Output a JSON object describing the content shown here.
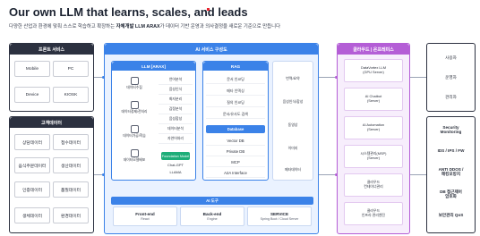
{
  "header": {
    "title": "Our own LLM that learns, scales, and leads",
    "subtitle_pre": "다양한 산업과 환경에 맞춰 스스로 학습하고 확장하는 ",
    "subtitle_bold": "자체개발 LLM ARAX",
    "subtitle_post": "가 데이터 기반 운영과 의사결정을 새로운 기준으로 만듭니다",
    "accent_color": "#e8242e"
  },
  "left_top": {
    "title": "프론트 서비스",
    "items": [
      "Mobile",
      "PC",
      "Device",
      "KIOSK"
    ]
  },
  "left_bottom": {
    "title": "고객데이터",
    "items": [
      "상담데이터",
      "접수데이터",
      "음식주문데이터",
      "생산데이터",
      "인증데이터",
      "품질데이터",
      "생체데이터",
      "환경데이터"
    ]
  },
  "center": {
    "title": "AI 서비스 구성도",
    "color": "#3b82e8",
    "llm": {
      "title": "LLM [ARAX]",
      "icons": [
        {
          "label": "데이터수집",
          "icon": "database-icon"
        },
        {
          "label": "데이터정제/전처리",
          "icon": "filter-icon"
        },
        {
          "label": "데이터가공/학습",
          "icon": "gear-icon"
        },
        {
          "label": "데이터모델배포",
          "icon": "cloud-icon"
        }
      ],
      "list": [
        "언어분석",
        "음성인식",
        "화자분리",
        "감정분석",
        "음성합성",
        "데이터분석",
        "자연어처리"
      ],
      "badge": "Foundation Model",
      "models": [
        "Chat-GPT",
        "LLAMA"
      ]
    },
    "rag": {
      "title": "RAG",
      "items": [
        "문서 인코딩",
        "메타 인덱싱",
        "질의 인코딩",
        "문서/유사도 검색"
      ],
      "database_title": "Database",
      "database_items": [
        "Vector DB",
        "Private DB",
        "MCP",
        "A2A Interface"
      ]
    },
    "mid_right": [
      "번역/요약",
      "음성인식/합성",
      "동영상",
      "이미지",
      "메타데이터"
    ],
    "tools": {
      "title": "AI 도구",
      "boxes": [
        {
          "name": "Front-end",
          "sub": "React"
        },
        {
          "name": "Back-end",
          "sub": "Engine"
        },
        {
          "name": "SERVICE",
          "sub": "Spring Boot / Cloud Server"
        }
      ]
    }
  },
  "cloud": {
    "title": "클라우드 | 온프레미스",
    "color": "#b45ed6",
    "items": [
      "DataVortex LLM\n(GPU Server)",
      "AI Chatbot\n(Server)",
      "AI Automation\n(Server)",
      "시스템관리(MSP)\n(Server)",
      "클라우드\n컨테이너관리",
      "클라우드\n인프라 관리엔진"
    ]
  },
  "right_top": {
    "items": [
      "사용자",
      "운영자",
      "관리자"
    ]
  },
  "right_bottom": {
    "items": [
      "Security\nMonitoring",
      "IDS / IPS / FW",
      "ANTI DDOS /\n해킹모방지",
      "DB 접근제어\n암호화",
      "보안관리 QoS"
    ]
  }
}
